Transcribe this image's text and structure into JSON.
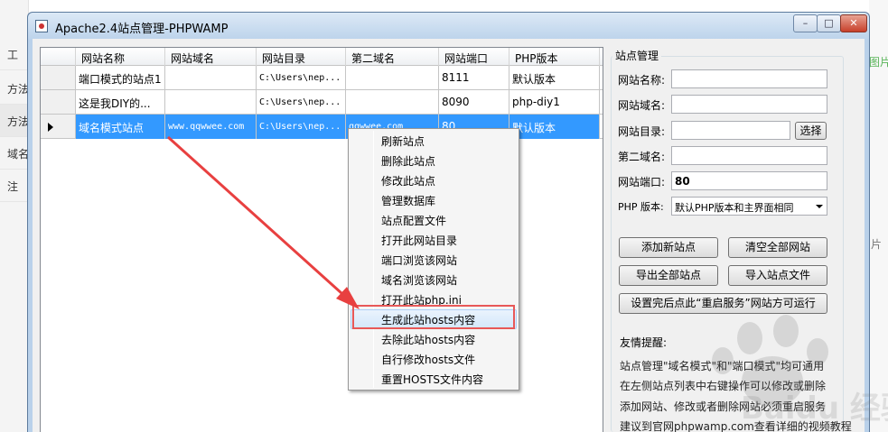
{
  "background": {
    "left_tabs": [
      "工",
      "方法",
      "方法",
      "域名模",
      "注"
    ],
    "right_text": "图片",
    "right_text2": "片"
  },
  "window": {
    "title": "Apache2.4站点管理-PHPWAMP",
    "min_glyph": "–",
    "max_glyph": "□",
    "close_glyph": "✕"
  },
  "grid": {
    "columns": [
      "网站名称",
      "网站域名",
      "网站目录",
      "第二域名",
      "网站端口",
      "PHP版本"
    ],
    "rows": [
      {
        "name": "端口模式的站点1",
        "domain": "",
        "dir": "C:\\Users\\nep...",
        "second": "",
        "port": "8111",
        "php": "默认版本",
        "selected": false
      },
      {
        "name": "这是我DIY的...",
        "domain": "",
        "dir": "C:\\Users\\nep...",
        "second": "",
        "port": "8090",
        "php": "php-diy1",
        "selected": false
      },
      {
        "name": "域名模式站点",
        "domain": "www.qqwwee.com",
        "dir": "C:\\Users\\nep...",
        "second": "qqwwee.com",
        "port": "80",
        "php": "默认版本",
        "selected": true
      }
    ]
  },
  "panel": {
    "title": "站点管理",
    "labels": {
      "name": "网站名称:",
      "domain": "网站域名:",
      "dir": "网站目录:",
      "second": "第二域名:",
      "port": "网站端口:",
      "php": "PHP 版本:"
    },
    "values": {
      "name": "",
      "domain": "",
      "dir": "",
      "second": "",
      "port": "80",
      "php": "默认PHP版本和主界面相同"
    },
    "buttons": {
      "choose": "选择",
      "add": "添加新站点",
      "clear": "清空全部网站",
      "export": "导出全部站点",
      "import": "导入站点文件",
      "restart_notice": "设置完后点此“重启服务”网站方可运行"
    },
    "notice": {
      "title": "友情提醒:",
      "lines": [
        "站点管理\"域名模式\"和\"端口模式\"均可通用",
        "在左侧站点列表中右键操作可以修改或删除",
        "添加网站、修改或者删除网站必须重启服务",
        "建议到官网phpwamp.com查看详细的视频教程"
      ]
    }
  },
  "context_menu": {
    "items": [
      "刷新站点",
      "删除此站点",
      "修改此站点",
      "管理数据库",
      "站点配置文件",
      "打开此网站目录",
      "端口浏览该网站",
      "域名浏览该网站",
      "打开此站php.ini",
      "生成此站hosts内容",
      "去除此站hosts内容",
      "自行修改hosts文件",
      "重置HOSTS文件内容"
    ],
    "hover_index": 9
  },
  "watermark": "Baidu 经验",
  "colors": {
    "selection": "#3399ff",
    "annotation": "#e84040",
    "titlebar": "#bcd3eb"
  }
}
